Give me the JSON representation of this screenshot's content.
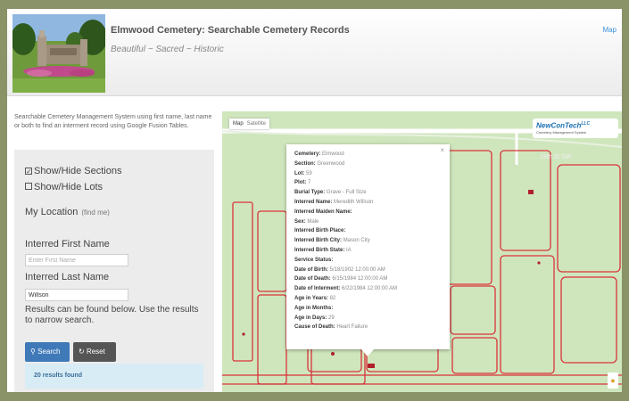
{
  "header": {
    "title": "Elmwood Cemetery: Searchable Cemetery Records",
    "subtitle": "Beautiful ~ Sacred ~ Historic",
    "map_link": "Map"
  },
  "sidebar": {
    "intro": "Searchable Cemetery Management System using first name, last name or both to find an interment record using Google Fusion Tables.",
    "show_sections": "Show/Hide Sections",
    "show_sections_checked": true,
    "show_lots": "Show/Hide Lots",
    "show_lots_checked": false,
    "my_location": "My Location",
    "find_me": "(find me)",
    "first_name_label": "Interred First Name",
    "first_name_placeholder": "Enter First Name",
    "first_name_value": "",
    "last_name_label": "Interred Last Name",
    "last_name_value": "Willson",
    "results_text": "Results can be found below.  Use the results to narrow search.",
    "search_label": "Search",
    "reset_label": "Reset",
    "results_found": "20 results found"
  },
  "map": {
    "type_map": "Map",
    "type_satellite": "Satellite",
    "brand": "NewConTech",
    "brand_suffix": "LLC",
    "brand_sub": "Cemetery Management System",
    "street": "19th St SW",
    "pegman_icon": "pegman-icon"
  },
  "infowindow": {
    "close": "×",
    "rows": [
      {
        "key": "Cemetery:",
        "value": "Elmwood"
      },
      {
        "key": "Section:",
        "value": "Greenwood"
      },
      {
        "key": "Lot:",
        "value": "59"
      },
      {
        "key": "Plot:",
        "value": "7"
      },
      {
        "key": "Burial Type:",
        "value": "Grave - Full Size"
      },
      {
        "key": "Interred Name:",
        "value": "Meredith Willson"
      },
      {
        "key": "Interred Maiden Name:",
        "value": ""
      },
      {
        "key": "Sex:",
        "value": "Male"
      },
      {
        "key": "Interred Birth Place:",
        "value": ""
      },
      {
        "key": "Interred Birth City:",
        "value": "Mason City"
      },
      {
        "key": "Interred Birth State:",
        "value": "IA"
      },
      {
        "key": "Service Status:",
        "value": ""
      },
      {
        "key": "Date of Birth:",
        "value": "5/18/1902 12:00:00 AM"
      },
      {
        "key": "Date of Death:",
        "value": "6/15/1984 12:00:00 AM"
      },
      {
        "key": "Date of Interment:",
        "value": "6/22/1984 12:00:00 AM"
      },
      {
        "key": "Age in Years:",
        "value": "82"
      },
      {
        "key": "Age in Months:",
        "value": ""
      },
      {
        "key": "Age in Days:",
        "value": "29"
      },
      {
        "key": "Cause of Death:",
        "value": "Heart Failure"
      }
    ]
  },
  "colors": {
    "accent": "#3f79b8",
    "frame": "#8a9268",
    "map_green": "#cce5bb",
    "section_line": "#d9333a"
  }
}
